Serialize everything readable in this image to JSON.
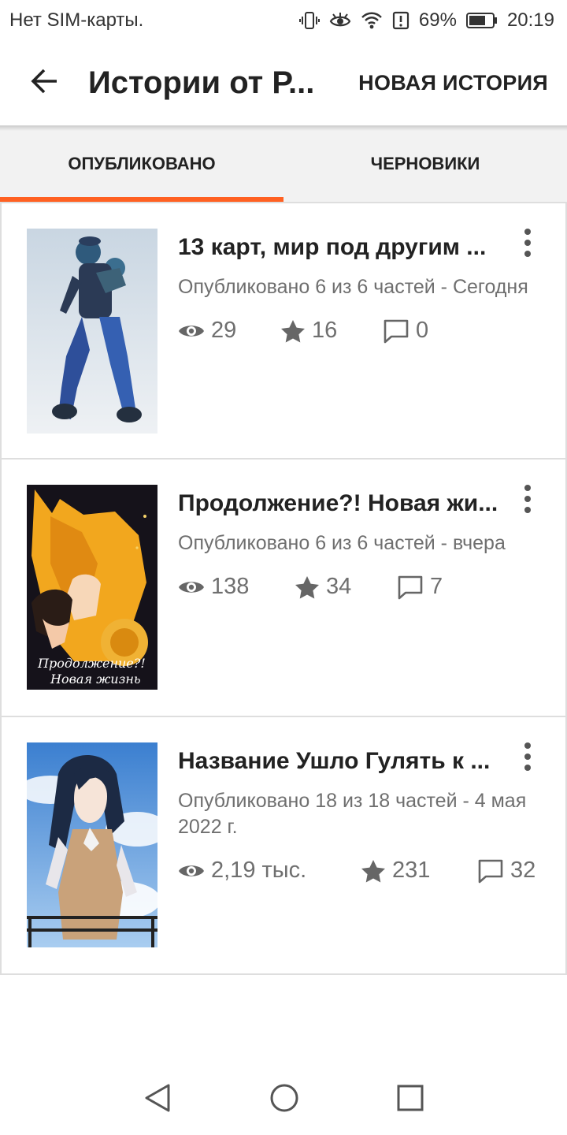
{
  "status_bar": {
    "carrier": "Нет SIM-карты.",
    "battery": "69%",
    "time": "20:19"
  },
  "app_bar": {
    "title": "Истории от Р...",
    "action": "НОВАЯ ИСТОРИЯ"
  },
  "tabs": [
    {
      "label": "ОПУБЛИКОВАНО",
      "active": true
    },
    {
      "label": "ЧЕРНОВИКИ",
      "active": false
    }
  ],
  "stories": [
    {
      "title": "13 карт, мир под другим ...",
      "status": "Опубликовано 6 из 6 частей - Сегодня",
      "views": "29",
      "votes": "16",
      "comments": "0"
    },
    {
      "title": "Продолжение?! Новая жи...",
      "status": "Опубликовано 6 из 6 частей - вчера",
      "views": "138",
      "votes": "34",
      "comments": "7"
    },
    {
      "title": "Название Ушло Гулять к ...",
      "status": "Опубликовано 18 из 18 частей - 4 мая 2022 г.",
      "views": "2,19 тыс.",
      "votes": "231",
      "comments": "32"
    }
  ],
  "cover_texts": {
    "story2_line1": "Продолжение?!",
    "story2_line2": "Новая жизнь"
  },
  "colors": {
    "accent": "#ff6122",
    "text_primary": "#222222",
    "text_secondary": "#6f6f6f"
  }
}
